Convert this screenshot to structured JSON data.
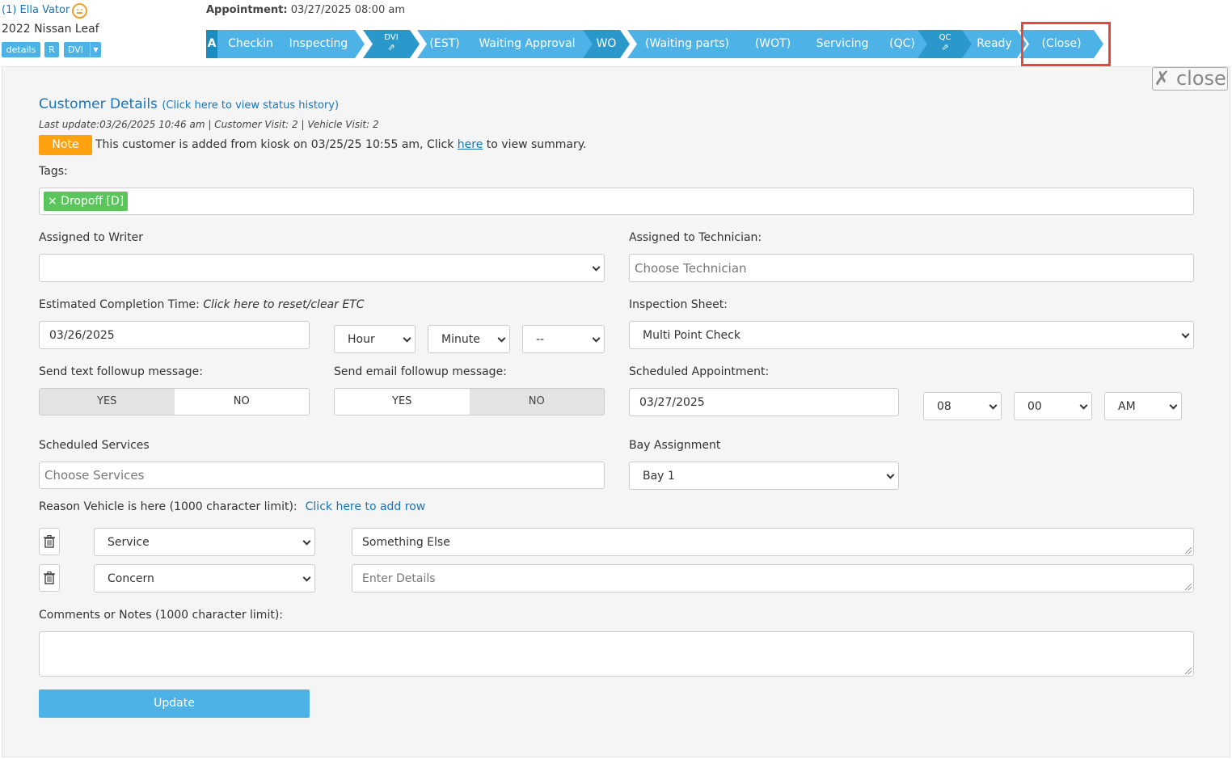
{
  "header": {
    "customer_name": "(1) Ella Vator",
    "vehicle": "2022 Nissan Leaf",
    "chips": [
      "details",
      "R",
      "DVI"
    ],
    "appointment_label": "Appointment:",
    "appointment_value": " 03/27/2025 08:00 am"
  },
  "status_bar": {
    "first_letter": "A",
    "steps": [
      {
        "label": "Checkin"
      },
      {
        "label": "Inspecting"
      },
      {
        "label": "DVI",
        "external": true
      },
      {
        "label": "(EST)"
      },
      {
        "label": "Waiting Approval"
      },
      {
        "label": "WO"
      },
      {
        "label": "(Waiting parts)"
      },
      {
        "label": "(WOT)"
      },
      {
        "label": "Servicing"
      },
      {
        "label": "(QC)"
      },
      {
        "label": "QC",
        "external": true
      },
      {
        "label": "Ready"
      },
      {
        "label": "(Close)"
      }
    ],
    "external_glyph": "⇗"
  },
  "close_button": "✗ close",
  "customer_details": {
    "title": "Customer Details",
    "status_history_link": "(Click here to view status history)",
    "last_update": "Last update:03/26/2025 10:46 am | Customer Visit: 2 | Vehicle Visit: 2",
    "note_badge": "Note",
    "note_text_before": "This customer is added from kiosk on 03/25/25 10:55 am, Click ",
    "note_link": "here",
    "note_text_after": " to view summary."
  },
  "tags": {
    "label": "Tags:",
    "items": [
      "× Dropoff [D]"
    ]
  },
  "writer": {
    "label": "Assigned to Writer",
    "value": ""
  },
  "technician": {
    "label": "Assigned to Technician:",
    "placeholder": "Choose Technician"
  },
  "etc": {
    "label": "Estimated Completion Time: ",
    "reset_link": "Click here to reset/clear ETC",
    "date": "03/26/2025",
    "hour": "Hour",
    "minute": "Minute",
    "ampm": "--"
  },
  "inspection": {
    "label": "Inspection Sheet:",
    "value": "Multi Point Check"
  },
  "text_followup": {
    "label": "Send text followup message:",
    "yes": "YES",
    "no": "NO",
    "selected": "YES"
  },
  "email_followup": {
    "label": "Send email followup message:",
    "yes": "YES",
    "no": "NO",
    "selected": "NO"
  },
  "scheduled_appt": {
    "label": "Scheduled Appointment:",
    "date": "03/27/2025",
    "hour": "08",
    "minute": "00",
    "ampm": "AM"
  },
  "services": {
    "label": "Scheduled Services",
    "placeholder": "Choose Services"
  },
  "bay": {
    "label": "Bay Assignment",
    "value": "Bay 1"
  },
  "reason": {
    "label": "Reason Vehicle is here (1000 character limit):",
    "add_row_link": "Click here to add row",
    "rows": [
      {
        "type": "Service",
        "details": "Something Else",
        "placeholder": ""
      },
      {
        "type": "Concern",
        "details": "",
        "placeholder": "Enter Details"
      }
    ]
  },
  "comments": {
    "label": "Comments or Notes (1000 character limit):",
    "value": ""
  },
  "update_button": "Update",
  "colors": {
    "accent": "#4db3e6",
    "status_dark": "#2b98cc",
    "status_light": "#4db3e6",
    "note": "#ffa20f",
    "tag": "#5cc45c",
    "highlight": "#e8473b"
  }
}
